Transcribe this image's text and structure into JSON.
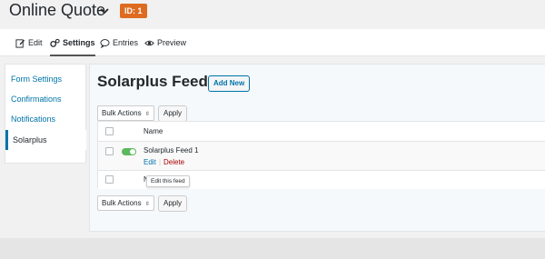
{
  "header": {
    "form_title": "Online Quote",
    "id_badge": "ID: 1",
    "accent_color": "#dd6b20"
  },
  "toolbar": {
    "items": [
      {
        "label": "Edit",
        "icon": "edit-icon"
      },
      {
        "label": "Settings",
        "icon": "gears-icon",
        "active": true
      },
      {
        "label": "Entries",
        "icon": "comment-icon"
      },
      {
        "label": "Preview",
        "icon": "eye-icon"
      }
    ]
  },
  "sidebar": {
    "items": [
      {
        "label": "Form Settings"
      },
      {
        "label": "Confirmations"
      },
      {
        "label": "Notifications"
      },
      {
        "label": "Solarplus",
        "active": true
      }
    ]
  },
  "main": {
    "title": "Solarplus Feeds",
    "add_new_label": "Add New",
    "bulk_actions": "Bulk Actions",
    "apply_label": "Apply",
    "column_name": "Name",
    "feeds": [
      {
        "name": "Solarplus Feed 1",
        "active": true,
        "actions": {
          "edit": "Edit",
          "delete": "Delete"
        }
      }
    ],
    "new_row_prefix": "N",
    "tooltip": "Edit this feed",
    "link_color": "#0073aa",
    "delete_color": "#a00"
  }
}
